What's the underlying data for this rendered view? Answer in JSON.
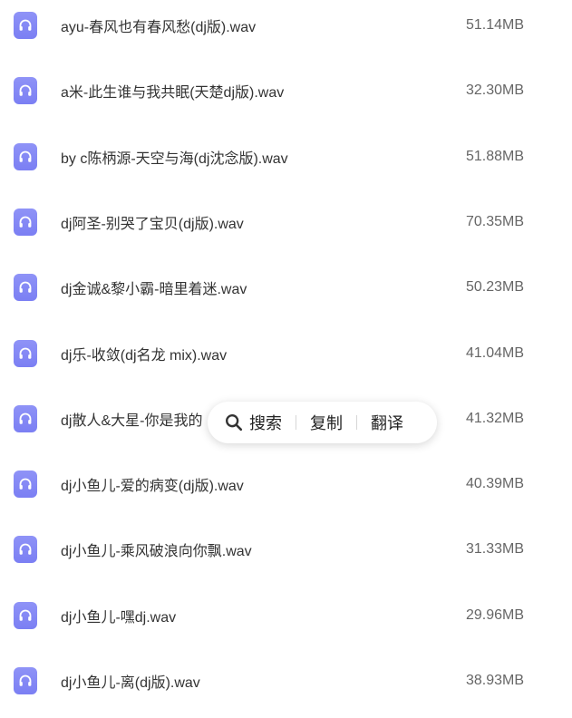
{
  "files": [
    {
      "name": "ayu-春风也有春风愁(dj版).wav",
      "size": "51.14MB"
    },
    {
      "name": "a米-此生谁与我共眠(天楚dj版).wav",
      "size": "32.30MB"
    },
    {
      "name": "by c陈柄源-天空与海(dj沈念版).wav",
      "size": "51.88MB"
    },
    {
      "name": "dj阿圣-别哭了宝贝(dj版).wav",
      "size": "70.35MB"
    },
    {
      "name": "dj金诚&黎小霸-暗里着迷.wav",
      "size": "50.23MB"
    },
    {
      "name": "dj乐-收敛(dj名龙 mix).wav",
      "size": "41.04MB"
    },
    {
      "name": "dj散人&大星-你是我的",
      "size": "41.32MB"
    },
    {
      "name": "dj小鱼儿-爱的病变(dj版).wav",
      "size": "40.39MB"
    },
    {
      "name": "dj小鱼儿-乘风破浪向你飘.wav",
      "size": "31.33MB"
    },
    {
      "name": "dj小鱼儿-嘿dj.wav",
      "size": "29.96MB"
    },
    {
      "name": "dj小鱼儿-离(dj版).wav",
      "size": "38.93MB"
    }
  ],
  "file_icon": "headphones-icon",
  "icon_color": "#7f83f5",
  "context_menu": {
    "search_label": "搜索",
    "copy_label": "复制",
    "translate_label": "翻译",
    "search_icon": "search-icon"
  }
}
